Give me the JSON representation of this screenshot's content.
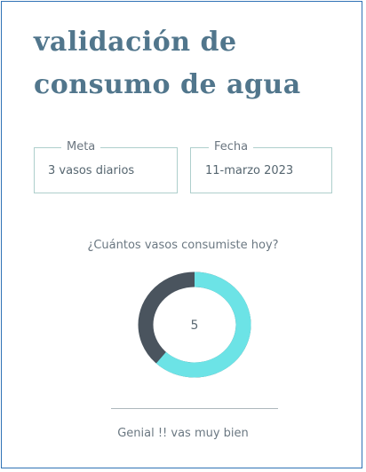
{
  "title_line1": "validación de",
  "title_line2": "consumo de agua",
  "goal": {
    "label": "Meta",
    "value": "3 vasos diarios"
  },
  "date": {
    "label": "Fecha",
    "value": "11-marzo 2023"
  },
  "question": "¿Cuántos vasos consumiste hoy?",
  "consumed": {
    "count": "5",
    "fraction": 0.62,
    "filled_color": "#6ce3e6",
    "remaining_color": "#4a545e"
  },
  "message": "Genial !! vas muy bien"
}
